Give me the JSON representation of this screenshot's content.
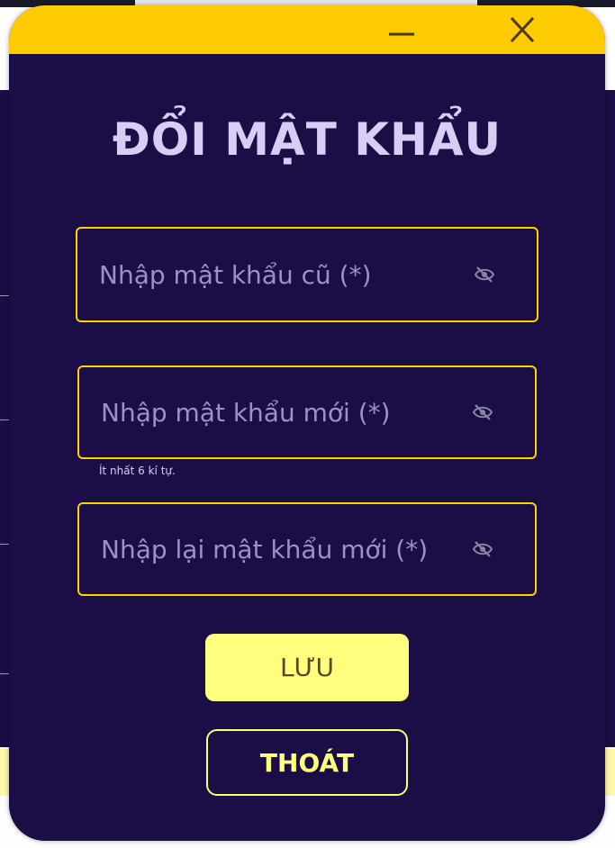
{
  "dialog": {
    "title": "ĐỔI MẬT KHẨU",
    "fields": [
      {
        "placeholder": "Nhập mật khẩu cũ (*)",
        "value": ""
      },
      {
        "placeholder": "Nhập mật khẩu mới (*)",
        "value": "",
        "hint": "Ít nhất 6 kí tự."
      },
      {
        "placeholder": "Nhập lại mật khẩu mới (*)",
        "value": ""
      }
    ],
    "save_label": "LƯU",
    "exit_label": "THOÁT"
  },
  "icons": {
    "minimize": "minimize-icon",
    "close": "close-icon",
    "toggle_visibility": "eye-off-icon"
  },
  "colors": {
    "background": "#1b0d45",
    "titlebar": "#fecb00",
    "field_border": "#fed400",
    "title_text": "#d7cdf5",
    "button_yellow": "#ffff7e"
  }
}
